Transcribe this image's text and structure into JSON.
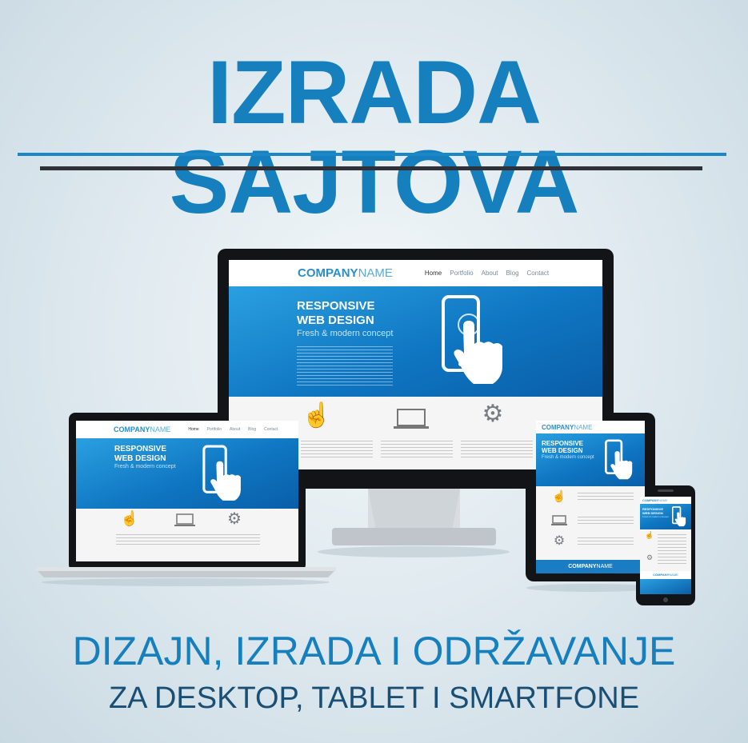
{
  "header": {
    "title": "IZRADA SAJTOVA"
  },
  "footer": {
    "line1": "DIZAJN, IZRADA I ODRŽAVANJE",
    "line2": "ZA DESKTOP, TABLET I SMARTFONE"
  },
  "mockup": {
    "logo_bold": "COMPANY",
    "logo_accent": "ANY",
    "logo_thin": "NAME",
    "nav": [
      "Home",
      "Portfolio",
      "About",
      "Blog",
      "Contact"
    ],
    "hero_title_1": "RESPONSIVE",
    "hero_title_2": "WEB DESIGN",
    "hero_subtitle": "Fresh & modern concept"
  },
  "colors": {
    "accent": "#1680bf",
    "dark": "#2e3238",
    "subtitle_dark": "#1a4f75"
  },
  "icons": [
    "touch-hand-icon",
    "laptop-icon",
    "gears-icon",
    "smartphone-touch-icon"
  ]
}
